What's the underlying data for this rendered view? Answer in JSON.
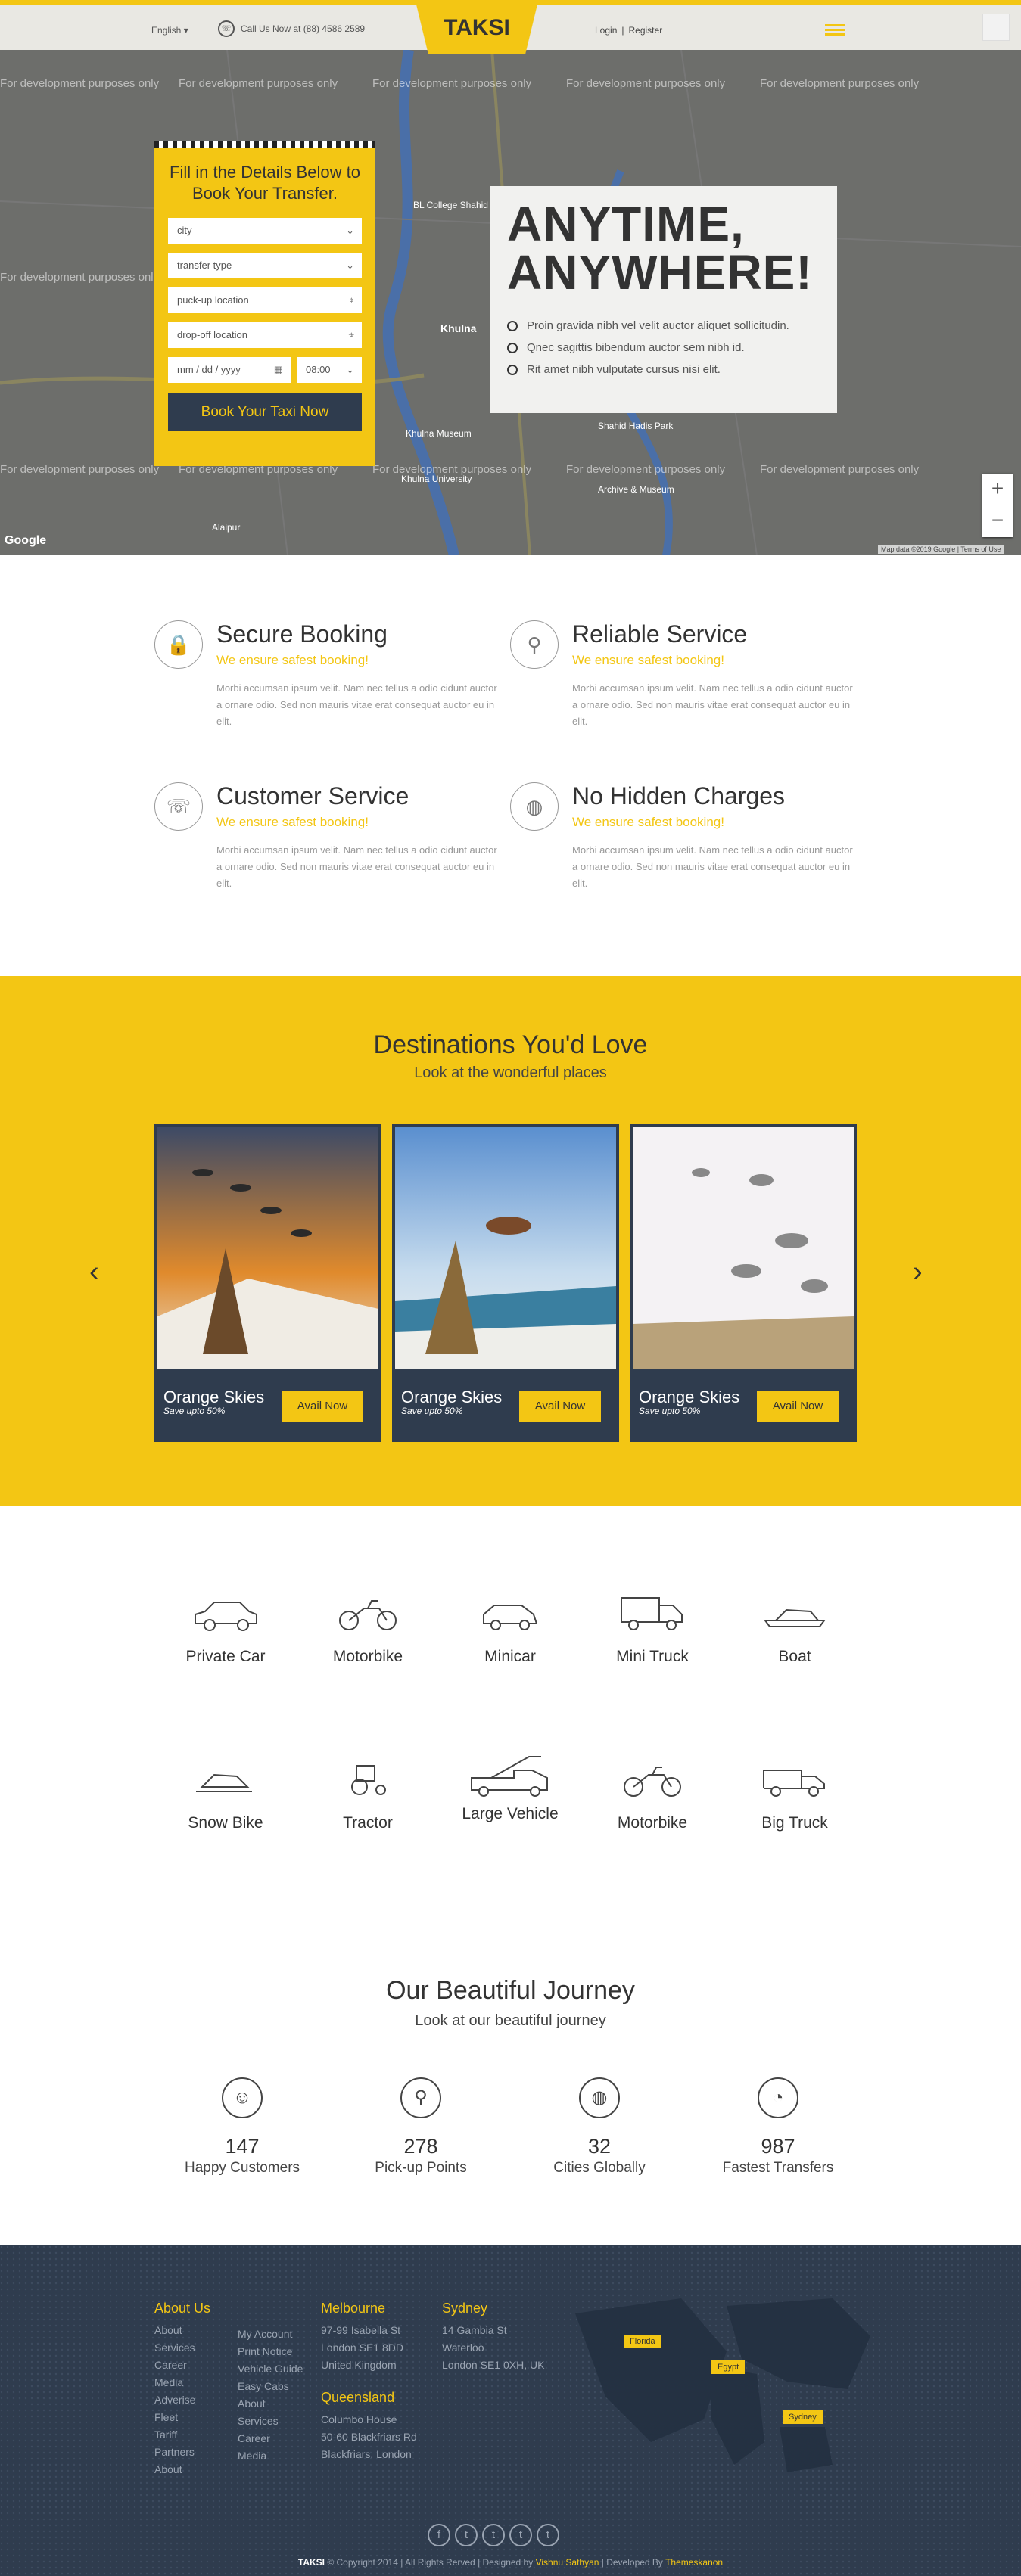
{
  "header": {
    "language": "English ▾",
    "phone": "Call Us Now at (88) 4586 2589",
    "logo": "TAKSI",
    "login": "Login",
    "register": "Register"
  },
  "hero": {
    "watermark": "For development purposes only",
    "form_title": "Fill in the Details Below to Book Your Transfer.",
    "city_placeholder": "city",
    "transfer_placeholder": "transfer type",
    "pickup_placeholder": "puck-up location",
    "dropoff_placeholder": "drop-off location",
    "date_placeholder": "mm / dd / yyyy",
    "time_value": "08:00",
    "book_button": "Book Your Taxi Now",
    "headline": "ANYTIME, ANYWHERE!",
    "bullets": [
      "Proin gravida nibh vel velit auctor aliquet sollicitudin.",
      "Qnec sagittis bibendum auctor sem nibh id.",
      "Rit amet nibh vulputate cursus nisi elit."
    ],
    "map_places": [
      "BL College Shahid",
      "Khulna",
      "Khulna Museum",
      "Shahid Hadis Park",
      "Khulna University",
      "Archive & Museum",
      "Alaipur"
    ],
    "zoom_in": "+",
    "zoom_out": "−",
    "google": "Google",
    "map_data": "Map data ©2019 Google | Terms of Use"
  },
  "features": [
    {
      "title": "Secure Booking",
      "sub": "We ensure safest booking!",
      "text": "Morbi accumsan ipsum velit. Nam nec tellus a odio cidunt auctor a ornare odio. Sed non mauris vitae erat consequat auctor eu in elit.",
      "icon": "lock-icon"
    },
    {
      "title": "Reliable Service",
      "sub": "We ensure safest booking!",
      "text": "Morbi accumsan ipsum velit. Nam nec tellus a odio cidunt auctor a ornare odio. Sed non mauris vitae erat consequat auctor eu in elit.",
      "icon": "pin-icon"
    },
    {
      "title": "Customer Service",
      "sub": "We ensure safest booking!",
      "text": "Morbi accumsan ipsum velit. Nam nec tellus a odio cidunt auctor a ornare odio. Sed non mauris vitae erat consequat auctor eu in elit.",
      "icon": "support-icon"
    },
    {
      "title": "No Hidden Charges",
      "sub": "We ensure safest booking!",
      "text": "Morbi accumsan ipsum velit. Nam nec tellus a odio cidunt auctor a ornare odio. Sed non mauris vitae erat consequat auctor eu in elit.",
      "icon": "globe-icon"
    }
  ],
  "destinations": {
    "title": "Destinations You'd Love",
    "subtitle": "Look at the wonderful places",
    "cards": [
      {
        "name": "Orange Skies",
        "save": "Save upto 50%",
        "button": "Avail Now"
      },
      {
        "name": "Orange Skies",
        "save": "Save upto 50%",
        "button": "Avail Now"
      },
      {
        "name": "Orange Skies",
        "save": "Save upto 50%",
        "button": "Avail Now"
      }
    ]
  },
  "vehicles": [
    "Private Car",
    "Motorbike",
    "Minicar",
    "Mini Truck",
    "Boat",
    "Snow Bike",
    "Tractor",
    "Large Vehicle",
    "Motorbike",
    "Big Truck"
  ],
  "journey": {
    "title": "Our Beautiful Journey",
    "subtitle": "Look at our beautiful journey",
    "stats": [
      {
        "n": "147",
        "l": "Happy Customers"
      },
      {
        "n": "278",
        "l": "Pick-up Points"
      },
      {
        "n": "32",
        "l": "Cities Globally"
      },
      {
        "n": "987",
        "l": "Fastest Transfers"
      }
    ]
  },
  "footer": {
    "about_title": "About Us",
    "about_links": [
      "About",
      "Services",
      "Career",
      "Media",
      "Adverise",
      "Fleet",
      "Tariff",
      "Partners",
      "About"
    ],
    "more_links": [
      "My Account",
      "Print Notice",
      "Vehicle Guide",
      "Easy Cabs",
      "About",
      "Services",
      "Career",
      "Media"
    ],
    "melbourne_title": "Melbourne",
    "melbourne": [
      "97-99 Isabella St",
      "London SE1 8DD",
      "United Kingdom"
    ],
    "queensland_title": "Queensland",
    "queensland": [
      "Columbo House",
      "50-60 Blackfriars Rd",
      "Blackfriars, London"
    ],
    "sydney_title": "Sydney",
    "sydney": [
      "14 Gambia St",
      "Waterloo",
      "London SE1 0XH, UK"
    ],
    "map_tags": [
      "Florida",
      "Egypt",
      "Sydney"
    ],
    "social": [
      "f",
      "t",
      "t",
      "t",
      "t"
    ],
    "copy_brand": "TAKSI",
    "copy_text": "© Copyright 2014 | All Rights Rerved | Designed by",
    "designer": "Vishnu Sathyan",
    "dev_text": "| Developed By",
    "developer": "Themeskanon"
  },
  "colors": {
    "accent": "#f3c614",
    "dark": "#2f3c4e"
  }
}
